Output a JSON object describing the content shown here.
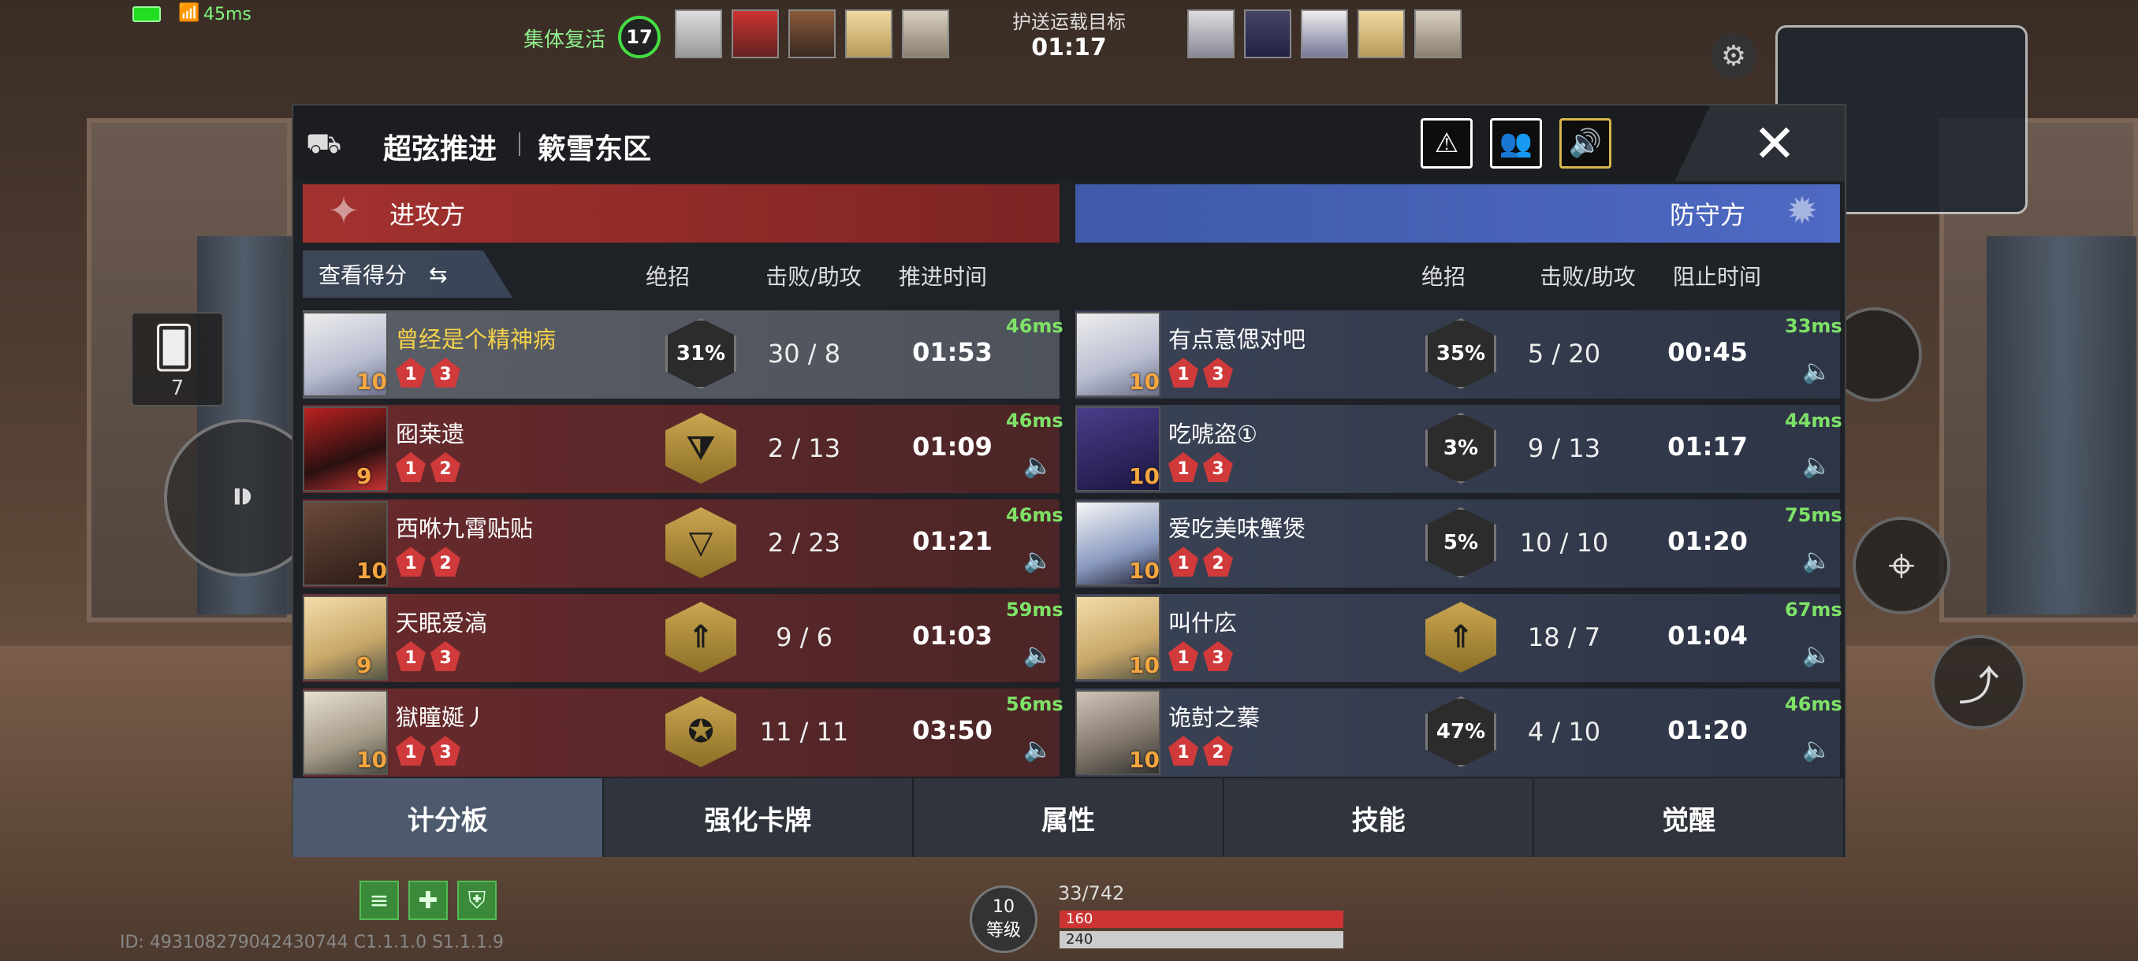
{
  "hud": {
    "ping": "45ms",
    "revive_label": "集体复活",
    "revive_count": "17",
    "objective_title": "护送运载目标",
    "objective_time": "01:17",
    "cards_count": "7",
    "ammo": "33/742",
    "hp": "160",
    "shield": "240",
    "level": "10",
    "level_label": "等级",
    "session_id": "ID: 4931082790424307­44 C1.1.1.0 S1.1.1.9"
  },
  "panel": {
    "mode": "超弦推进",
    "map": "簌雪东区",
    "attack_team": "进攻方",
    "defend_team": "防守方",
    "view_score": "查看得分",
    "headers": {
      "ult": "绝招",
      "kda": "击败/助攻",
      "push_time": "推进时间",
      "block_time": "阻止时间"
    },
    "close_icon": "close-icon"
  },
  "attackers": [
    {
      "name": "曾经是个精神病",
      "level": "10",
      "badge1": "1",
      "badge2": "3",
      "ult": "31%",
      "ult_ready": false,
      "kda": "30 / 8",
      "time": "01:53",
      "ms": "46ms",
      "self": true
    },
    {
      "name": "囮桒遗",
      "level": "9",
      "badge1": "1",
      "badge2": "2",
      "ult": "",
      "ult_ready": true,
      "kda": "2 / 13",
      "time": "01:09",
      "ms": "46ms",
      "self": false
    },
    {
      "name": "西咻九霄贴贴",
      "level": "10",
      "badge1": "1",
      "badge2": "2",
      "ult": "",
      "ult_ready": true,
      "kda": "2 / 23",
      "time": "01:21",
      "ms": "46ms",
      "self": false
    },
    {
      "name": "天眠爱滈",
      "level": "9",
      "badge1": "1",
      "badge2": "3",
      "ult": "",
      "ult_ready": true,
      "kda": "9 / 6",
      "time": "01:03",
      "ms": "59ms",
      "self": false
    },
    {
      "name": "獄瞳娫丿",
      "level": "10",
      "badge1": "1",
      "badge2": "3",
      "ult": "",
      "ult_ready": true,
      "kda": "11 / 11",
      "time": "03:50",
      "ms": "56ms",
      "self": false
    }
  ],
  "defenders": [
    {
      "name": "有点意偲对吧",
      "level": "10",
      "badge1": "1",
      "badge2": "3",
      "ult": "35%",
      "ult_ready": false,
      "kda": "5 / 20",
      "time": "00:45",
      "ms": "33ms"
    },
    {
      "name": "吃唬盗①",
      "level": "10",
      "badge1": "1",
      "badge2": "3",
      "ult": "3%",
      "ult_ready": false,
      "kda": "9 / 13",
      "time": "01:17",
      "ms": "44ms"
    },
    {
      "name": "爱吃美味蟹煲",
      "level": "10",
      "badge1": "1",
      "badge2": "2",
      "ult": "5%",
      "ult_ready": false,
      "kda": "10 / 10",
      "time": "01:20",
      "ms": "75ms"
    },
    {
      "name": "叫什庅",
      "level": "10",
      "badge1": "1",
      "badge2": "3",
      "ult": "",
      "ult_ready": true,
      "kda": "18 / 7",
      "time": "01:04",
      "ms": "67ms"
    },
    {
      "name": "诡尌之蓁",
      "level": "10",
      "badge1": "1",
      "badge2": "2",
      "ult": "47%",
      "ult_ready": false,
      "kda": "4 / 10",
      "time": "01:20",
      "ms": "46ms"
    }
  ],
  "tabs": [
    "计分板",
    "强化卡牌",
    "属性",
    "技能",
    "觉醒"
  ],
  "colors": {
    "attack": "#a3322f",
    "defend": "#3e5aa8",
    "ping_green": "#7ee267",
    "self_name": "#f5d24a",
    "level_orange": "#f5a640"
  }
}
